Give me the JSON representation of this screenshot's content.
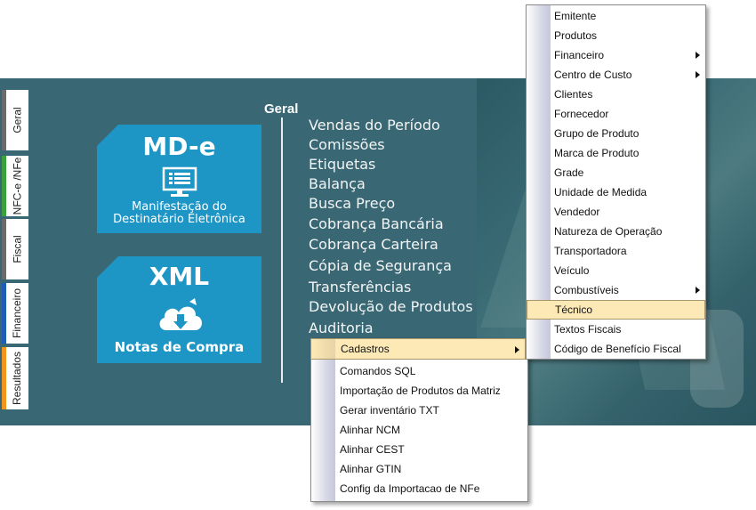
{
  "tabs": [
    {
      "label": "Geral",
      "color": "#6b6b6b"
    },
    {
      "label": "NFC-e /NFe",
      "color": "#3aa23a"
    },
    {
      "label": "Fiscal",
      "color": "#6b6b6b"
    },
    {
      "label": "Financeiro",
      "color": "#1e5eb8"
    },
    {
      "label": "Resultados",
      "color": "#f0961e"
    }
  ],
  "cards": {
    "mde": {
      "title": "MD-e",
      "line1": "Manifestação do",
      "line2": "Destinatário Eletrônica"
    },
    "xml": {
      "title": "XML",
      "subtitle": "Notas de Compra"
    }
  },
  "geral": {
    "title": "Geral",
    "items": [
      "Vendas do Período",
      "Comissões",
      "Etiquetas",
      "Balança",
      "Busca Preço",
      "Cobrança Bancária",
      "Cobrança Carteira",
      "Cópia de Segurança",
      "Transferências",
      "Devolução de Produtos",
      "Auditoria"
    ]
  },
  "auditoria_menu": {
    "open_item": "Cadastros",
    "items": [
      "Comandos SQL",
      "Importação de Produtos da Matriz",
      "Gerar inventário TXT",
      "Alinhar NCM",
      "Alinhar CEST",
      "Alinhar GTIN",
      "Config da Importacao de NFe"
    ]
  },
  "cadastros_menu": {
    "items": [
      {
        "label": "Emitente",
        "submenu": false
      },
      {
        "label": "Produtos",
        "submenu": false
      },
      {
        "label": "Financeiro",
        "submenu": true
      },
      {
        "label": "Centro de Custo",
        "submenu": true
      },
      {
        "label": "Clientes",
        "submenu": false
      },
      {
        "label": "Fornecedor",
        "submenu": false
      },
      {
        "label": "Grupo de Produto",
        "submenu": false
      },
      {
        "label": "Marca de Produto",
        "submenu": false
      },
      {
        "label": "Grade",
        "submenu": false
      },
      {
        "label": "Unidade de Medida",
        "submenu": false
      },
      {
        "label": "Vendedor",
        "submenu": false
      },
      {
        "label": "Natureza de Operação",
        "submenu": false
      },
      {
        "label": "Transportadora",
        "submenu": false
      },
      {
        "label": "Veículo",
        "submenu": false
      },
      {
        "label": "Combustíveis",
        "submenu": true
      },
      {
        "label": "Técnico",
        "submenu": false,
        "selected": true
      },
      {
        "label": "Textos Fiscais",
        "submenu": false
      },
      {
        "label": "Código de Benefício Fiscal",
        "submenu": false
      }
    ]
  },
  "colors": {
    "panel": "#3a6774",
    "card": "#1d96c6",
    "highlight": "#fde9b6"
  }
}
